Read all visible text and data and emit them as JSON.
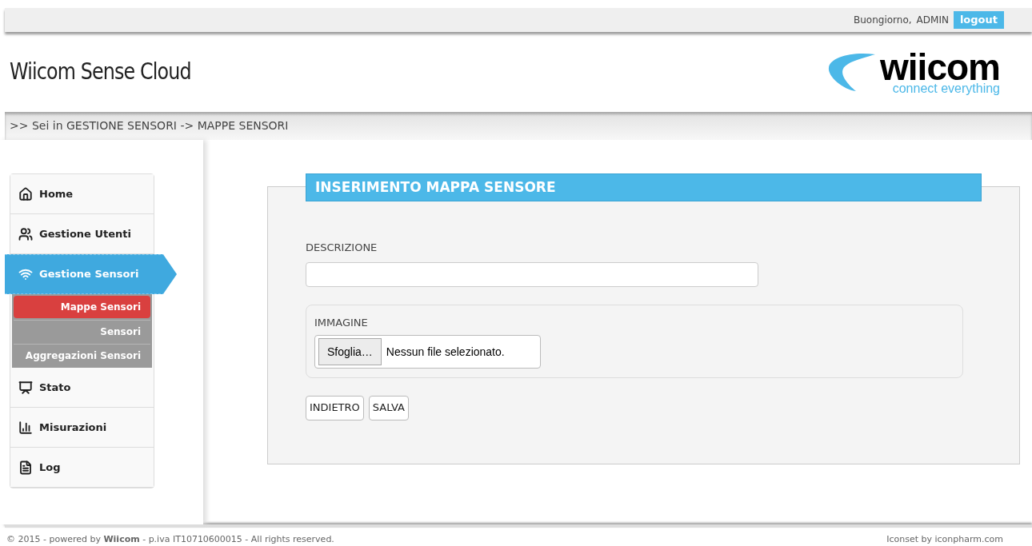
{
  "top_bar": {
    "greeting": "Buongiorno,",
    "user": "ADMIN",
    "logout": "logout"
  },
  "header": {
    "title": "Wiicom Sense Cloud",
    "logo": {
      "name": "wiicom",
      "tagline": "connect everything"
    }
  },
  "breadcrumb": ">> Sei in GESTIONE SENSORI -> MAPPE SENSORI",
  "sidebar": {
    "items": [
      {
        "label": "Home",
        "selected": false
      },
      {
        "label": "Gestione Utenti",
        "selected": false
      },
      {
        "label": "Gestione Sensori",
        "selected": true,
        "children": [
          {
            "label": "Mappe Sensori",
            "selected": true
          },
          {
            "label": "Sensori",
            "selected": false
          },
          {
            "label": "Aggregazioni Sensori",
            "selected": false
          }
        ]
      },
      {
        "label": "Stato",
        "selected": false
      },
      {
        "label": "Misurazioni",
        "selected": false
      },
      {
        "label": "Log",
        "selected": false
      }
    ]
  },
  "form": {
    "title": "INSERIMENTO MAPPA SENSORE",
    "description_label": "DESCRIZIONE",
    "image_label": "IMMAGINE",
    "file_button": "Sfoglia…",
    "file_status": "Nessun file selezionato.",
    "buttons": [
      "INDIETRO",
      "SALVA"
    ]
  },
  "footer": {
    "left": "© 2015 - powered by **Wiicom** - p.iva IT10710600015 - All rights reserved.",
    "right": "Iconset by iconpharm.com"
  }
}
